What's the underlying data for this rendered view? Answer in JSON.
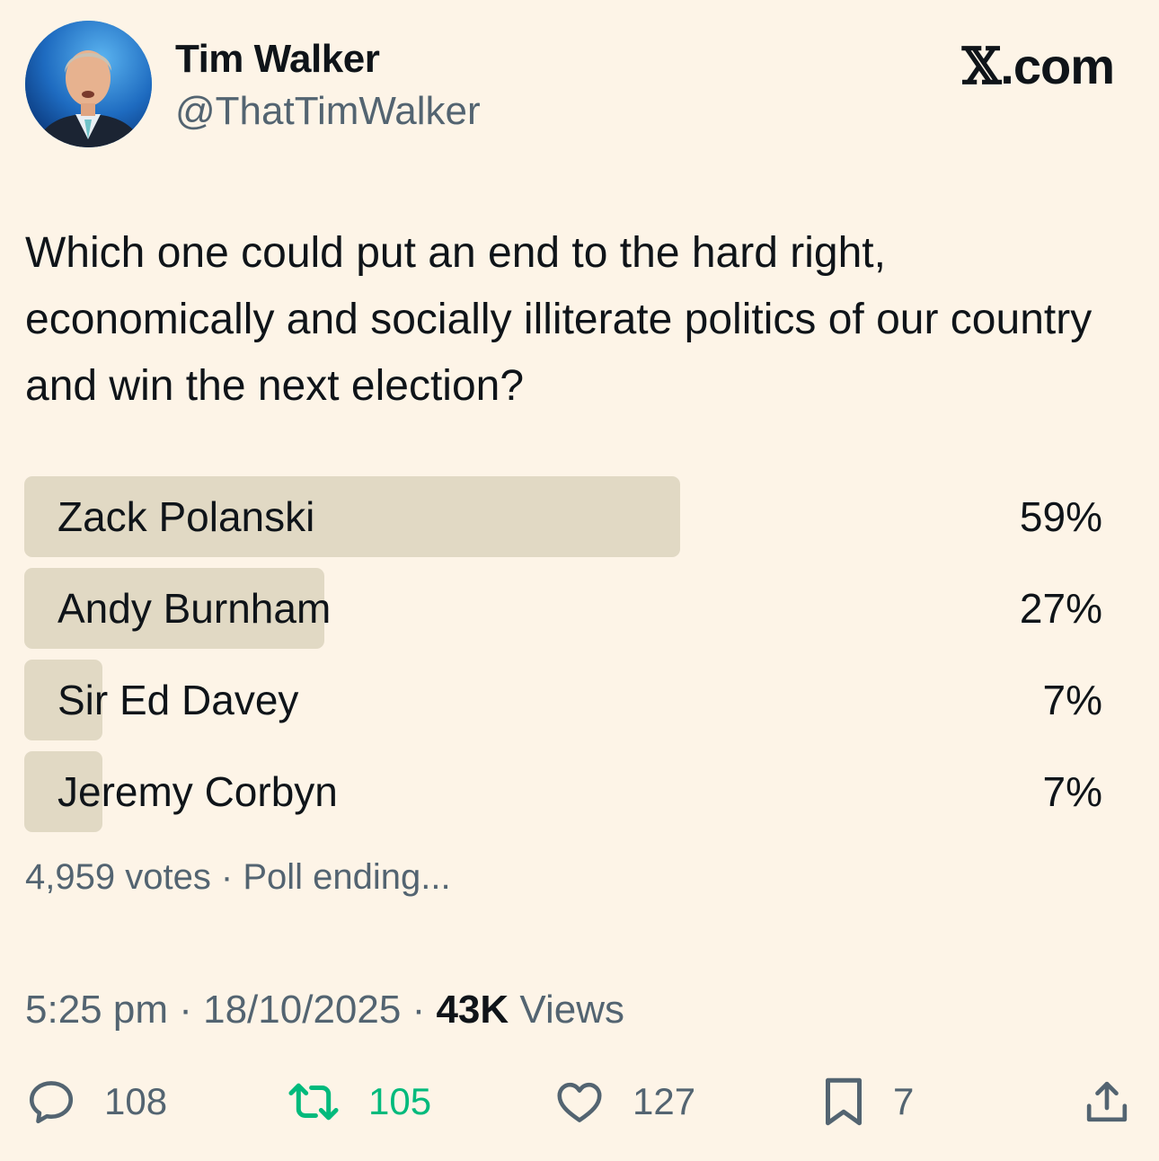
{
  "author": {
    "display_name": "Tim Walker",
    "handle": "@ThatTimWalker",
    "avatar_icon": "profile-photo"
  },
  "brand": {
    "logo_glyph": "𝕏",
    "suffix": ".com"
  },
  "tweet": {
    "text": "Which one could put an end to the hard right, economically and socially illiterate politics of our country and win the next election?"
  },
  "poll": {
    "options": [
      {
        "label": "Zack Polanski",
        "percent_label": "59%",
        "percent": 59
      },
      {
        "label": "Andy Burnham",
        "percent_label": "27%",
        "percent": 27
      },
      {
        "label": "Sir Ed Davey",
        "percent_label": "7%",
        "percent": 7
      },
      {
        "label": "Jeremy Corbyn",
        "percent_label": "7%",
        "percent": 7
      }
    ],
    "meta": "4,959 votes · Poll ending..."
  },
  "timestamp": {
    "time": "5:25 pm",
    "separator1": "·",
    "date": "18/10/2025",
    "separator2": "·",
    "views_count": "43K",
    "views_label": "Views"
  },
  "actions": {
    "reply": {
      "count": "108",
      "icon": "reply-icon"
    },
    "retweet": {
      "count": "105",
      "icon": "retweet-icon",
      "color": "#00ba7c"
    },
    "like": {
      "count": "127",
      "icon": "heart-icon"
    },
    "bookmark": {
      "count": "7",
      "icon": "bookmark-icon"
    },
    "share": {
      "icon": "share-icon"
    }
  },
  "colors": {
    "background": "#fdf4e7",
    "poll_bar": "#e1d9c4",
    "text_primary": "#0f1419",
    "text_secondary": "#536471",
    "retweet_active": "#00ba7c"
  }
}
